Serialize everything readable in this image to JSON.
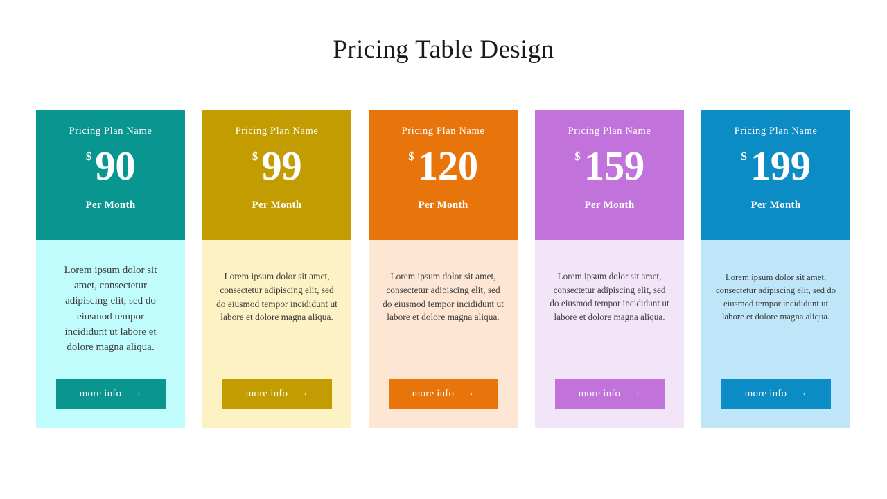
{
  "page": {
    "title": "Pricing Table Design",
    "background_color": "#ffffff"
  },
  "cards": [
    {
      "plan_name": "Pricing Plan Name",
      "currency": "$",
      "amount": "90",
      "period": "Per Month",
      "description": "Lorem ipsum dolor sit amet, consectetur adipiscing elit, sed do eiusmod tempor incididunt ut labore et dolore magna aliqua.",
      "button_label": "more info",
      "button_icon": "arrow-right-icon",
      "arrow_glyph": "→",
      "header_color": "#099690",
      "body_color": "#bffcfb",
      "button_color": "#0b958f",
      "text_color": "#ffffff"
    },
    {
      "plan_name": "Pricing Plan Name",
      "currency": "$",
      "amount": "99",
      "period": "Per Month",
      "description": "Lorem ipsum dolor sit amet, consectetur adipiscing elit, sed do eiusmod tempor incididunt ut labore et dolore magna aliqua.",
      "button_label": "more info",
      "button_icon": "arrow-right-icon",
      "arrow_glyph": "→",
      "header_color": "#c29c00",
      "body_color": "#fdf2c4",
      "button_color": "#c29c00",
      "text_color": "#ffffff"
    },
    {
      "plan_name": "Pricing Plan Name",
      "currency": "$",
      "amount": "120",
      "period": "Per Month",
      "description": "Lorem ipsum dolor sit amet, consectetur adipiscing elit, sed do eiusmod tempor incididunt ut labore et dolore magna aliqua.",
      "button_label": "more info",
      "button_icon": "arrow-right-icon",
      "arrow_glyph": "→",
      "header_color": "#e8750c",
      "body_color": "#fde6d3",
      "button_color": "#e8750c",
      "text_color": "#ffffff"
    },
    {
      "plan_name": "Pricing Plan Name",
      "currency": "$",
      "amount": "159",
      "period": "Per Month",
      "description": "Lorem ipsum dolor sit amet, consectetur adipiscing elit, sed do eiusmod tempor incididunt ut labore et dolore magna aliqua.",
      "button_label": "more info",
      "button_icon": "arrow-right-icon",
      "arrow_glyph": "→",
      "header_color": "#c273db",
      "body_color": "#f2e5f7",
      "button_color": "#c273db",
      "text_color": "#ffffff"
    },
    {
      "plan_name": "Pricing Plan Name",
      "currency": "$",
      "amount": "199",
      "period": "Per Month",
      "description": "Lorem ipsum dolor sit amet, consectetur adipiscing elit, sed do eiusmod tempor incididunt ut labore et dolore magna aliqua.",
      "button_label": "more info",
      "button_icon": "arrow-right-icon",
      "arrow_glyph": "→",
      "header_color": "#0b8cc4",
      "body_color": "#bfe5f8",
      "button_color": "#0b8cc4",
      "text_color": "#ffffff"
    }
  ]
}
